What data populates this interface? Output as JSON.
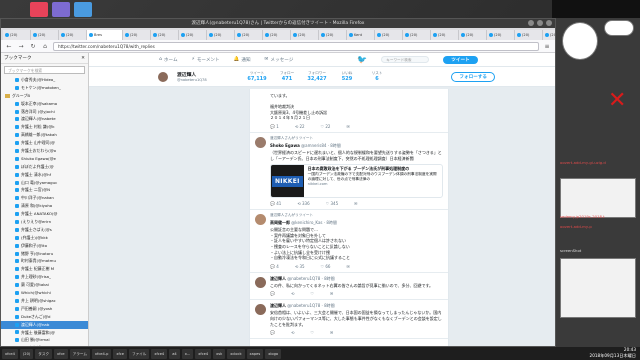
{
  "window_title": "渡辺輝人(@nabeteru1Q78)さん | Twitterからの返信付きツイート - Mozilla Firefox",
  "url": "https://twitter.com/nabeteru1Q78/with_replies",
  "tabs": [
    "(20)",
    "(20)",
    "(20)",
    "Bres",
    "(20)",
    "(20)",
    "(20)",
    "(20)",
    "(20)",
    "(20)",
    "(20)",
    "(20)",
    "Kent",
    "(20)",
    "(20)",
    "(20)",
    "(20)",
    "(20)",
    "(20)",
    "(20)",
    "(20)",
    "旭川都",
    "審議再",
    "(20)",
    "(20)"
  ],
  "sidebar": {
    "header": "ブックマーク",
    "search_placeholder": "ブックマークを検索",
    "items": [
      {
        "label": "小倉秀夫(@Hideo_",
        "type": "bm"
      },
      {
        "label": "モトケン(@motoken_",
        "type": "bm"
      },
      {
        "label": "グループB",
        "type": "folder"
      },
      {
        "label": "坂本正幸(@sakamo",
        "type": "bm"
      },
      {
        "label": "落合洋司 (@yjochi",
        "type": "bm"
      },
      {
        "label": "渡辺輝人(@nabete",
        "type": "bm"
      },
      {
        "label": "弁護士 村松 謙(@k",
        "type": "bm"
      },
      {
        "label": "高橋雄一郎(@takah",
        "type": "bm"
      },
      {
        "label": "弁護士 山中理司(@",
        "type": "bm"
      },
      {
        "label": "弁護士おだわら(@o",
        "type": "bm"
      },
      {
        "label": "Shiuko Egawa(@e",
        "type": "bm"
      },
      {
        "label": "ぽぽだよ弁護士(@",
        "type": "bm"
      },
      {
        "label": "弁護士 清水(@hf",
        "type": "bm"
      },
      {
        "label": "山口 竜(@yamaguc",
        "type": "bm"
      },
      {
        "label": "弁護士 二宮(@N",
        "type": "bm"
      },
      {
        "label": "中川洋子(@nakan",
        "type": "bm"
      },
      {
        "label": "清原 和(@kiyoha",
        "type": "bm"
      },
      {
        "label": "弁護士 ANATAKO(@",
        "type": "bm"
      },
      {
        "label": "(えりえり@erirn",
        "type": "bm"
      },
      {
        "label": "弁護士さばえ(@s",
        "type": "bm"
      },
      {
        "label": "(弁護士)(@kkk",
        "type": "bm"
      },
      {
        "label": "伊藤和子(@ito",
        "type": "bm"
      },
      {
        "label": "猪野 亨(@inotoru",
        "type": "bm"
      },
      {
        "label": "町村泰貴(@matmu",
        "type": "bm"
      },
      {
        "label": "弁護士 紀藤正樹 M",
        "type": "bm"
      },
      {
        "label": "井上理砂(@risa_",
        "type": "bm"
      },
      {
        "label": "蘭 可愛(@takai",
        "type": "bm"
      },
      {
        "label": "Which(@whichi",
        "type": "bm"
      },
      {
        "label": "井上 耕明(@shigac",
        "type": "bm"
      },
      {
        "label": "戸田善嗣 (@yosh",
        "type": "bm"
      },
      {
        "label": "Dukeさんご(@d",
        "type": "bm"
      },
      {
        "label": "渡辺輝人(@nab",
        "type": "bm",
        "selected": true
      },
      {
        "label": "弁護士 後藤富和(@",
        "type": "bm"
      },
      {
        "label": "山田 勝(@trmal",
        "type": "bm"
      },
      {
        "label": "こくあおげ(@kok",
        "type": "bm"
      },
      {
        "label": "ワーキングプア研",
        "type": "bm"
      },
      {
        "label": "弁護士 小口貴雄(@",
        "type": "bm"
      }
    ]
  },
  "twitter_nav": {
    "home": "ホーム",
    "moments": "モーメント",
    "notifications": "通知",
    "messages": "メッセージ",
    "search_placeholder": "キーワード検索",
    "tweet_button": "ツイート"
  },
  "profile": {
    "name": "渡辺輝人",
    "handle": "@nabeteru1Q78",
    "stats": [
      {
        "label": "ツイート",
        "value": "67,119"
      },
      {
        "label": "フォロー",
        "value": "471"
      },
      {
        "label": "フォロワー",
        "value": "32,427"
      },
      {
        "label": "いいね",
        "value": "529"
      },
      {
        "label": "リスト",
        "value": "6"
      }
    ],
    "follow_button": "フォローする"
  },
  "tweets": [
    {
      "context": "",
      "name": "",
      "handle": "",
      "time": "",
      "body": "ています。\n\n福井地裁判決\n大飯原発3、4号機差し止め訴訟\n２０１４年５月２１日",
      "acts": [
        "1",
        "22",
        "22"
      ],
      "avatar_color": "#ffffff"
    },
    {
      "context": "渡辺輝人さんがリツイート",
      "name": "Shoko Egawa",
      "handle": "@amneris84 · 8時間",
      "time": "",
      "body": "（世界経済のスピードに遅れまいと、個人的な規制緩和を要望先送りする姿勢を「さつきる」とし「ーアーデン氏、日本の刑事法制度下、突然の不処理処理調査）日本経済新聞",
      "card": {
        "logo": "NIKKEI",
        "title": "日本の腐敗政治を下がる ブーデン法氏が刑事処理制度の",
        "text": "一国内ブーデン法政権の下で支配対刑のウスブーデン体調の刑事法制度を実際の論理に対して、世の点で刑事法律の",
        "domain": "nikkei.com"
      },
      "acts": [
        "41",
        "336",
        "345"
      ],
      "avatar_color": "#9a7b6b"
    },
    {
      "context": "渡辺輝人さんがリツイート",
      "name": "高岡健一郎",
      "handle": "@kenichiro_Kas · 8時間",
      "time": "",
      "body": "公開証言の主要な問題で…\n・案件再議論を対象日を外して\n・証人を雇いやすい特定個人は許されない\n・捜査のレースを守らないことに反論しない\n・よい法上に抗議し全を受けけ捜\n・自動冷凍法を令和日に公式に抗議すること",
      "acts": [
        "4",
        "35",
        "66"
      ],
      "avatar_color": "#b48b6e"
    },
    {
      "context": "",
      "name": "渡辺輝人",
      "handle": "@nabeteru1Q78 · 8時間",
      "time": "",
      "body": "この件、私に向かってくるネット右翼の皆さんの論旨が見事に揃いので、多分、回避です。",
      "acts": [
        "",
        "",
        ""
      ],
      "avatar_color": "#8a6a5a"
    },
    {
      "context": "",
      "name": "渡辺輝人",
      "handle": "@nabeteru1Q78 · 8時間",
      "time": "",
      "body": "安倍首相は、いよいよ、三大会と開催で、日本国の国益を損なってしまったんじゃないか。国内向けの少ないパフォーマンス等に、大した事態も事件性がなくもなくブーデンとの会談を設定したことを批判ます。",
      "acts": [
        "",
        "",
        ""
      ],
      "avatar_color": "#8a6a5a"
    }
  ],
  "right_panel": {
    "links": [
      "oovert-add-my-gi-uzig.d",
      "sedemy.jp2019c-2018.t",
      "oovert-add-my-p",
      "screenShot"
    ]
  },
  "taskbar": {
    "items": [
      "xfce4",
      "(20)",
      "タスク",
      "xfce",
      "アラーム",
      "xfce4-p",
      "xfce",
      "ファイル",
      "xfce4",
      "a4",
      "x...",
      "xfce4",
      "xsk",
      "xclock",
      "xapes",
      "xlogo"
    ],
    "clock_time": "20:43",
    "clock_date": "2018年09月13日木曜日"
  }
}
